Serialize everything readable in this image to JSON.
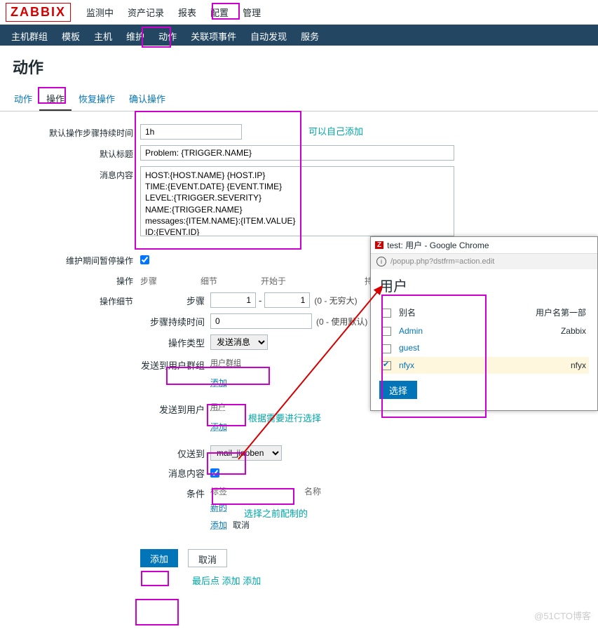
{
  "logo": "ZABBIX",
  "top_nav": [
    "监测中",
    "资产记录",
    "报表",
    "配置",
    "管理"
  ],
  "sub_nav": [
    "主机群组",
    "模板",
    "主机",
    "维护",
    "动作",
    "关联项事件",
    "自动发现",
    "服务"
  ],
  "page_title": "动作",
  "tabs": {
    "t0": "动作",
    "t1": "操作",
    "t2": "恢复操作",
    "t3": "确认操作"
  },
  "form": {
    "step_duration_label": "默认操作步骤持续时间",
    "step_duration_value": "1h",
    "default_title_label": "默认标题",
    "default_title_value": "Problem: {TRIGGER.NAME}",
    "message_label": "消息内容",
    "message_value": "HOST:{HOST.NAME} {HOST.IP}\nTIME:{EVENT.DATE} {EVENT.TIME}\nLEVEL:{TRIGGER.SEVERITY}\nNAME:{TRIGGER.NAME}\nmessages:{ITEM.NAME}:{ITEM.VALUE}\nID:{EVENT.ID}",
    "maintenance_label": "维护期间暂停操作",
    "operations_label": "操作",
    "ops_head": {
      "steps": "步骤",
      "details": "细节",
      "start": "开始于",
      "duration": "持续时间"
    },
    "op_detail_label": "操作细节",
    "steps_label": "步骤",
    "steps_from": "1",
    "steps_to": "1",
    "steps_hint": "(0 - 无穷大)",
    "step_dur_label": "步骤持续时间",
    "step_dur_value": "0",
    "step_dur_hint": "(0 - 使用默认)",
    "op_type_label": "操作类型",
    "op_type_value": "发送消息",
    "send_group_label": "发送到用户群组",
    "send_group_head": "用户群组",
    "add_link": "添加",
    "send_user_label": "发送到用户",
    "send_user_head": "用户",
    "only_send_label": "仅送到",
    "only_send_value": "mail_jiaoben",
    "msg_content_label": "消息内容",
    "conditions_label": "条件",
    "cond_head1": "标签",
    "cond_head2": "名称",
    "new_link": "新的",
    "cancel_link": "取消",
    "add_btn": "添加",
    "cancel_btn": "取消"
  },
  "annotations": {
    "custom_add": "可以自己添加",
    "select_need": "根据需要进行选择",
    "prev_config": "选择之前配制的",
    "final_add": "最后点 添加 添加"
  },
  "popup": {
    "title": "test: 用户 - Google Chrome",
    "url": "/popup.php?dstfrm=action.edit",
    "heading": "用户",
    "col_alias": "别名",
    "col_username": "用户名第一部",
    "users": [
      {
        "alias": "Admin",
        "name": "Zabbix",
        "checked": false
      },
      {
        "alias": "guest",
        "name": "",
        "checked": false
      },
      {
        "alias": "nfyx",
        "name": "nfyx",
        "checked": true
      }
    ],
    "select_btn": "选择"
  },
  "watermark": "@51CTO博客"
}
